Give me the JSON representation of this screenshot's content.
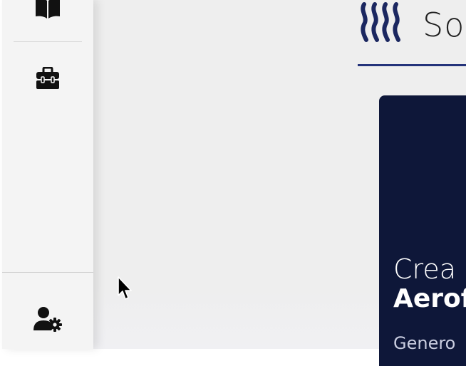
{
  "sidebar": {
    "items": [
      {
        "icon": "book-icon"
      },
      {
        "icon": "toolbox-icon"
      }
    ],
    "bottom_item": {
      "icon": "user-settings-icon"
    }
  },
  "header": {
    "logo_icon": "steam-heat-icon",
    "brand_text": "So"
  },
  "hero_card": {
    "line1": "Crea",
    "line2": "Aerof",
    "line3": "Genero"
  },
  "colors": {
    "accent": "#24337a",
    "card_background": "#0e1739",
    "sidebar_background": "#f4f4f4",
    "main_background": "#eeeeee"
  }
}
